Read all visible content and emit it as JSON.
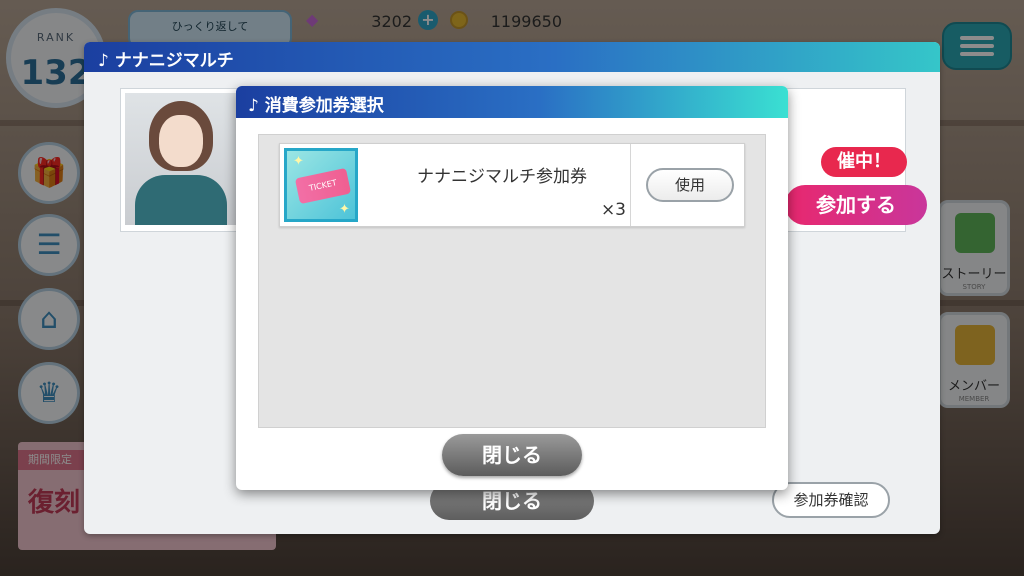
{
  "hud": {
    "rank_label": "RANK",
    "rank_value": "132",
    "news_banner_text": "ひっくり返して",
    "gems": "3202",
    "gem_plus": "+",
    "coins": "1199650"
  },
  "side_menu": {
    "limited_tag": "期間限定",
    "limited_title": "復刻"
  },
  "right_menu": {
    "story_label": "ストーリー",
    "story_sub": "STORY",
    "member_label": "メンバー",
    "member_sub": "MEMBER"
  },
  "outer_dialog": {
    "title": "♪ ナナニジマルチ",
    "event_held": "催中！",
    "join_label": "参加する",
    "close_label": "閉じる",
    "ticket_confirm_label": "参加券確認"
  },
  "inner_dialog": {
    "title": "♪ 消費参加券選択",
    "ticket": {
      "name": "ナナニジマルチ参加券",
      "quantity": "×3",
      "thumb_text": "TICKET",
      "use_label": "使用"
    },
    "close_label": "閉じる"
  },
  "colors": {
    "header_start": "#1b3fa0",
    "header_end": "#3ae0d2",
    "accent_pink": "#e8284e",
    "menu_teal": "#2ba8b5"
  },
  "icons": {
    "gem": "gem-icon",
    "coin": "coin-icon",
    "menu": "hamburger-menu-icon",
    "gift": "gift-icon",
    "list": "list-icon",
    "home": "home-icon",
    "crown": "crown-icon"
  }
}
